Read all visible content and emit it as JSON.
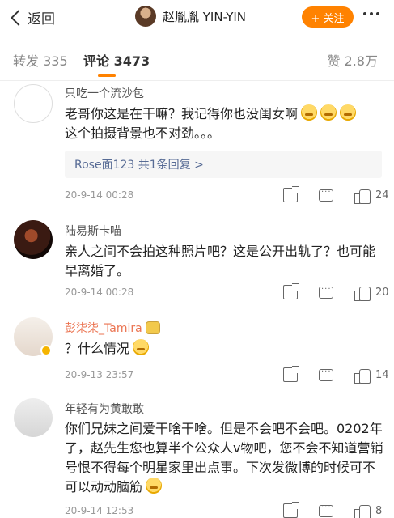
{
  "topbar": {
    "back_label": "返回",
    "profile_name": "赵胤胤 YIN-YIN",
    "follow_label": "+ 关注"
  },
  "tabs": {
    "repost": "转发 335",
    "comment": "评论 3473",
    "like": "赞 2.8万"
  },
  "comments": [
    {
      "username": "只吃一个流沙包",
      "text": "老哥你这是在干嘛？我记得你也没闺女啊",
      "text2": "这个拍摄背景也不对劲。。。",
      "reply": "Rose面123  共1条回复 >",
      "time": "20-9-14 00:28",
      "likes": "24"
    },
    {
      "username": "陆易斯卡喵",
      "text": "亲人之间不会拍这种照片吧？这是公开出轨了？也可能早离婚了。",
      "time": "20-9-14 00:28",
      "likes": "20"
    },
    {
      "username": "彭柒柒_Tamira",
      "text": "？什么情况",
      "time": "20-9-13 23:57",
      "likes": "14"
    },
    {
      "username": "年轻有为黄敢敢",
      "text": "你们兄妹之间爱干啥干啥。但是不会吧不会吧。0202年了，赵先生您也算半个公众人v物吧，您不会不知道营销号恨不得每个明星家里出点事。下次发微博的时候可不可以动动脑筋",
      "time": "20-9-14 12:53",
      "likes": "8"
    }
  ],
  "colors": {
    "accent": "#ff8200",
    "reply_link": "#576b95"
  }
}
